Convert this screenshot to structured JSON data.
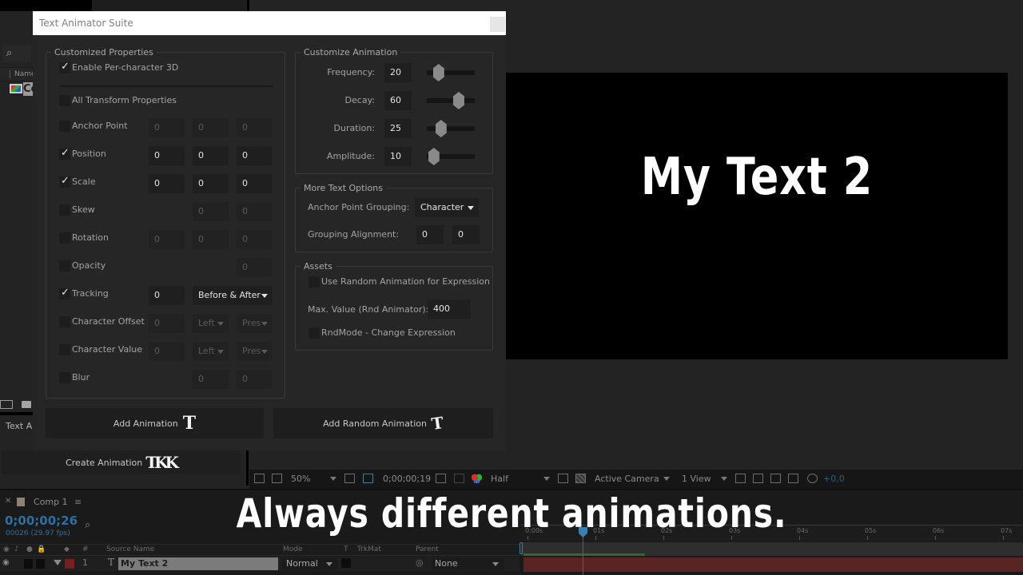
{
  "project_panel": {
    "search_icon": "search-icon",
    "column_name": "Name",
    "item_label": "Co",
    "bottom_tab_label": "Text Ar"
  },
  "plugin": {
    "title": "Text Animator Suite",
    "customized_properties": {
      "legend": "Customized Properties",
      "enable_per_char_3d": {
        "label": "Enable Per-character 3D",
        "checked": true
      },
      "all_transform": {
        "label": "All Transform Properties",
        "checked": false
      },
      "rows": [
        {
          "label": "Anchor Point",
          "checked": false,
          "values": [
            "0",
            "0",
            "0"
          ]
        },
        {
          "label": "Position",
          "checked": true,
          "values": [
            "0",
            "0",
            "0"
          ]
        },
        {
          "label": "Scale",
          "checked": true,
          "values": [
            "0",
            "0",
            "0"
          ]
        },
        {
          "label": "Skew",
          "checked": false,
          "values": [
            "0",
            "0"
          ]
        },
        {
          "label": "Rotation",
          "checked": false,
          "values": [
            "0",
            "0",
            "0"
          ]
        },
        {
          "label": "Opacity",
          "checked": false,
          "values": [
            "0"
          ]
        },
        {
          "label": "Tracking",
          "checked": true,
          "values": [
            "0"
          ],
          "dropdown": "Before & After"
        },
        {
          "label": "Character Offset",
          "checked": false,
          "values": [
            "0"
          ],
          "dropdown": "Left",
          "dropdown2": "Pres"
        },
        {
          "label": "Character Value",
          "checked": false,
          "values": [
            "0"
          ],
          "dropdown": "Left",
          "dropdown2": "Pres"
        },
        {
          "label": "Blur",
          "checked": false,
          "values": [
            "0",
            "0"
          ]
        }
      ]
    },
    "customize_animation": {
      "legend": "Customize Animation",
      "sliders": [
        {
          "label": "Frequency:",
          "value": "20",
          "position": 0.18
        },
        {
          "label": "Decay:",
          "value": "60",
          "position": 0.6
        },
        {
          "label": "Duration:",
          "value": "25",
          "position": 0.23
        },
        {
          "label": "Amplitude:",
          "value": "10",
          "position": 0.08
        }
      ]
    },
    "more_text_options": {
      "legend": "More Text Options",
      "anchor_grouping_label": "Anchor Point Grouping:",
      "anchor_grouping_value": "Character",
      "grouping_alignment_label": "Grouping Alignment:",
      "grouping_alignment_values": [
        "0",
        "0"
      ]
    },
    "assets": {
      "legend": "Assets",
      "use_random": {
        "label": "Use Random Animation for Expression",
        "checked": false
      },
      "max_value_label": "Max. Value (Rnd Animator):",
      "max_value": "400",
      "rnd_mode": {
        "label": "RndMode - Change Expression",
        "checked": false
      }
    },
    "buttons": {
      "add_animation": "Add Animation",
      "add_animation_glyph": "T",
      "add_random_animation": "Add Random Animation",
      "add_random_glyph": "T",
      "create_animation": "Create Animation",
      "create_animation_glyph": "TKK"
    }
  },
  "viewer": {
    "text": "My Text 2",
    "toolbar": {
      "zoom": "50%",
      "timecode": "0;00;00;19",
      "resolution": "Half",
      "camera": "Active Camera",
      "views": "1 View",
      "exposure": "+0,0"
    }
  },
  "timeline": {
    "tab_label": "Comp 1",
    "timecode": "0;00;00;26",
    "frames": "00026 (29.97 fps)",
    "columns": {
      "hash": "#",
      "source_name": "Source Name",
      "mode": "Mode",
      "t": "T",
      "trkmat": "TrkMat",
      "parent": "Parent"
    },
    "layer": {
      "number": "1",
      "name": "My Text 2",
      "mode": "Normal",
      "parent": "None",
      "type_glyph": "T"
    },
    "ruler_ticks": [
      "0:00s",
      "01s",
      "02s",
      "03s",
      "04s",
      "05s",
      "06s",
      "07s"
    ]
  },
  "caption": "Always different animations."
}
